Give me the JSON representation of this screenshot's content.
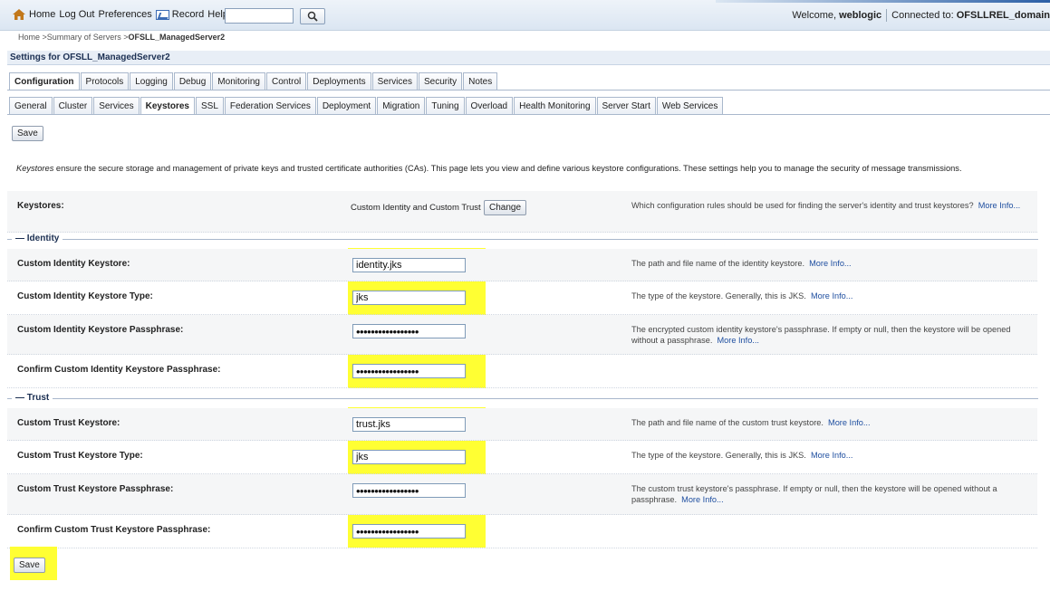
{
  "toolbar": {
    "home": "Home",
    "logout": "Log Out",
    "preferences": "Preferences",
    "record": "Record",
    "help": "Help",
    "search_value": "",
    "welcome_prefix": "Welcome, ",
    "user": "weblogic",
    "connected_prefix": "Connected to: ",
    "domain": "OFSLLREL_domain"
  },
  "breadcrumb": {
    "trail": "Home >Summary of Servers >",
    "current": "OFSLL_ManagedServer2"
  },
  "settings_title": "Settings for OFSLL_ManagedServer2",
  "tabs_primary": [
    "Configuration",
    "Protocols",
    "Logging",
    "Debug",
    "Monitoring",
    "Control",
    "Deployments",
    "Services",
    "Security",
    "Notes"
  ],
  "tabs_secondary": [
    "General",
    "Cluster",
    "Services",
    "Keystores",
    "SSL",
    "Federation Services",
    "Deployment",
    "Migration",
    "Tuning",
    "Overload",
    "Health Monitoring",
    "Server Start",
    "Web Services"
  ],
  "save_label": "Save",
  "description": {
    "term": "Keystores",
    "text": " ensure the secure storage and management of private keys and trusted certificate authorities (CAs). This page lets you view and define various keystore configurations. These settings help you to manage the security of message transmissions."
  },
  "keystores": {
    "label": "Keystores:",
    "value": "Custom Identity and Custom Trust",
    "change_label": "Change",
    "help": "Which configuration rules should be used for finding the server's identity and trust keystores?",
    "more": "More Info..."
  },
  "identity": {
    "section": "Identity",
    "fields": [
      {
        "label": "Custom Identity Keystore:",
        "value": "identity.jks",
        "help": "The path and file name of the identity keystore.",
        "more": "More Info..."
      },
      {
        "label": "Custom Identity Keystore Type:",
        "value": "jks",
        "help": "The type of the keystore. Generally, this is JKS.",
        "more": "More Info..."
      },
      {
        "label": "Custom Identity Keystore Passphrase:",
        "value": "•••••••••••••••••",
        "help": "The encrypted custom identity keystore's passphrase. If empty or null, then the keystore will be opened without a passphrase.",
        "more": "More Info..."
      },
      {
        "label": "Confirm Custom Identity Keystore Passphrase:",
        "value": "•••••••••••••••••",
        "help": "",
        "more": ""
      }
    ]
  },
  "trust": {
    "section": "Trust",
    "fields": [
      {
        "label": "Custom Trust Keystore:",
        "value": "trust.jks",
        "help": "The path and file name of the custom trust keystore.",
        "more": "More Info..."
      },
      {
        "label": "Custom Trust Keystore Type:",
        "value": "jks",
        "help": "The type of the keystore. Generally, this is JKS.",
        "more": "More Info..."
      },
      {
        "label": "Custom Trust Keystore Passphrase:",
        "value": "•••••••••••••••••",
        "help": "The custom trust keystore's passphrase. If empty or null, then the keystore will be opened without a passphrase.",
        "more": "More Info..."
      },
      {
        "label": "Confirm Custom Trust Keystore Passphrase:",
        "value": "•••••••••••••••••",
        "help": "",
        "more": ""
      }
    ]
  },
  "colors": {
    "highlight": "#ffff33",
    "link": "#1f4fa0",
    "title_bar": "#e8eef6"
  }
}
